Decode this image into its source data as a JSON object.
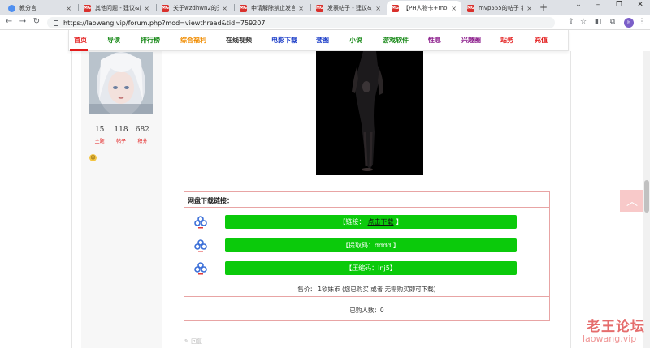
{
  "browser": {
    "tabs": [
      {
        "title": "教分言",
        "favicon": "chrome"
      },
      {
        "title": "其他问题 - 建议&反馈",
        "favicon": "red"
      },
      {
        "title": "关于wzdhwn2的天天",
        "favicon": "red"
      },
      {
        "title": "申请解除禁止发言_老",
        "favicon": "red"
      },
      {
        "title": "发表帖子 - 建议&反馈",
        "favicon": "red"
      },
      {
        "title": "【PH人物卡+mod】",
        "favicon": "red",
        "active": true
      },
      {
        "title": "mvp555的帖子 老王",
        "favicon": "red"
      }
    ],
    "favicon_label": "MG",
    "new_tab": "+",
    "window_controls": [
      "⌄",
      "–",
      "❐",
      "✕"
    ],
    "tab_close": "×",
    "back_icon": "←",
    "forward_icon": "→",
    "reload_icon": "↻",
    "url": "https://laowang.vip/forum.php?mod=viewthread&tid=759207",
    "toolbar_icons": [
      "⇪",
      "☆",
      "◧",
      "⧉"
    ],
    "profile_initial": "h",
    "menu_icon": "⋮"
  },
  "site_nav": {
    "items": [
      {
        "label": "首页",
        "color": "#e31c1c"
      },
      {
        "label": "导读",
        "color": "#1a8a1a"
      },
      {
        "label": "排行榜",
        "color": "#1a8a1a"
      },
      {
        "label": "综合福利",
        "color": "#f08c00"
      },
      {
        "label": "在线视频",
        "color": "#333333"
      },
      {
        "label": "电影下载",
        "color": "#1a3cc8"
      },
      {
        "label": "套图",
        "color": "#1a3cc8"
      },
      {
        "label": "小说",
        "color": "#1a8a1a"
      },
      {
        "label": "游戏软件",
        "color": "#1a8a1a"
      },
      {
        "label": "性息",
        "color": "#8a1a8a"
      },
      {
        "label": "兴趣圈",
        "color": "#8a1a8a"
      },
      {
        "label": "站务",
        "color": "#e31c1c"
      },
      {
        "label": "充值",
        "color": "#e31c1c"
      }
    ]
  },
  "user": {
    "stats": [
      {
        "num": "15",
        "label": "主题"
      },
      {
        "num": "118",
        "label": "帖子"
      },
      {
        "num": "682",
        "label": "积分"
      }
    ],
    "emoji": "☺"
  },
  "download": {
    "title": "网盘下载链接：",
    "link_prefix": "【链接：",
    "link_text": "点击下载",
    "link_suffix": "】",
    "code_btn": "【提取码：dddd 】",
    "unzip_btn": "【压缩码：lnj5】",
    "price": "售价：  1钦妹币  (您已购买 或者 无需购买即可下载)",
    "buyers": "已购人数：0"
  },
  "reply_hint": "✎  回复",
  "scroll_top_icon": "︿",
  "watermark": {
    "line1": "老王论坛",
    "line2": "laowang.vip"
  }
}
